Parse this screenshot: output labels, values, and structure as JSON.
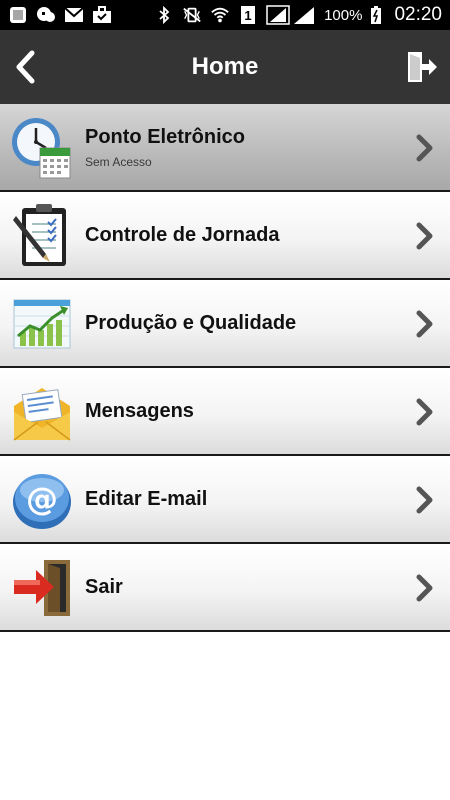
{
  "status_bar": {
    "battery_text": "100%",
    "time": "02:20",
    "sim_number": "1",
    "icons": [
      "gallery-icon",
      "hangouts-icon",
      "gmail-icon",
      "briefcase-icon",
      "bluetooth-icon",
      "vibrate-icon",
      "wifi-icon",
      "sim-icon",
      "signal-icon",
      "battery-icon"
    ]
  },
  "header": {
    "title": "Home",
    "back_icon": "chevron-left-icon",
    "logout_icon": "exit-door-icon",
    "background": "#343434"
  },
  "menu": {
    "items": [
      {
        "label": "Ponto Eletrônico",
        "sublabel": "Sem Acesso",
        "icon": "clock-calendar-icon",
        "active": true
      },
      {
        "label": "Controle de Jornada",
        "sublabel": "",
        "icon": "clipboard-pen-icon",
        "active": false
      },
      {
        "label": "Produção e Qualidade",
        "sublabel": "",
        "icon": "growth-chart-icon",
        "active": false
      },
      {
        "label": "Mensagens",
        "sublabel": "",
        "icon": "envelope-icon",
        "active": false
      },
      {
        "label": "Editar E-mail",
        "sublabel": "",
        "icon": "at-sign-icon",
        "active": false
      },
      {
        "label": "Sair",
        "sublabel": "",
        "icon": "exit-arrow-door-icon",
        "active": false
      }
    ]
  }
}
